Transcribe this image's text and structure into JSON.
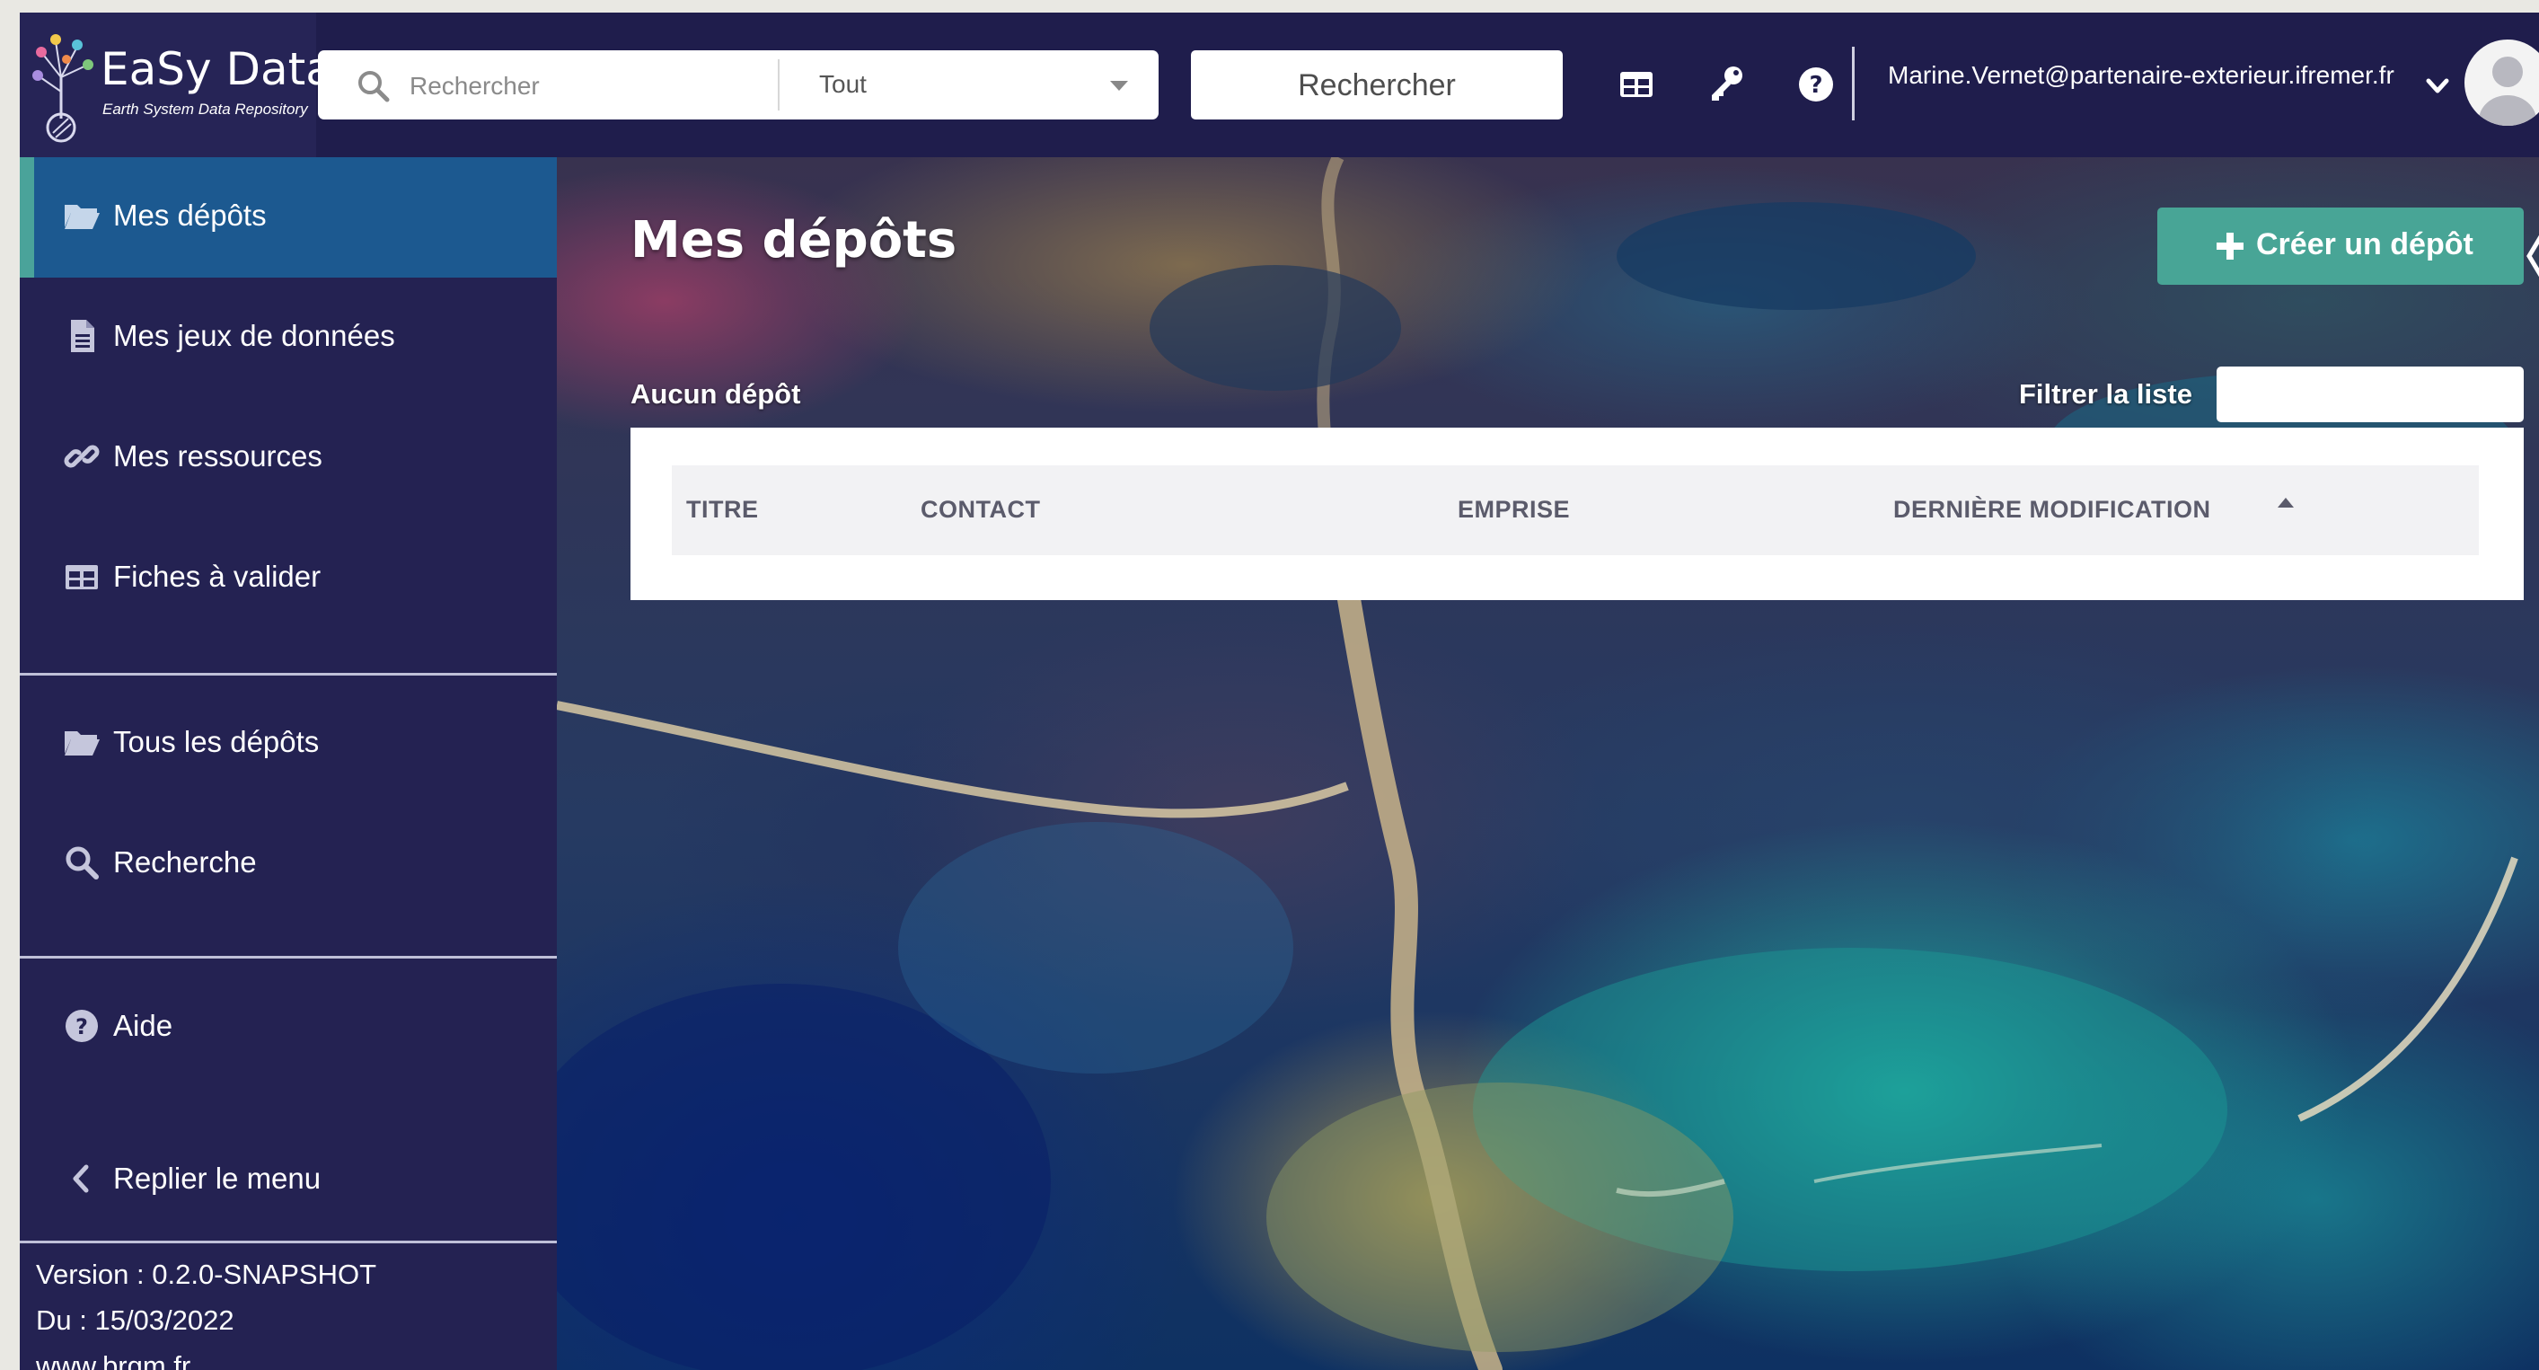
{
  "app": {
    "name": "EaSy Data",
    "tagline": "Earth System Data Repository"
  },
  "header": {
    "search_placeholder": "Rechercher",
    "scope_selected": "Tout",
    "search_button": "Rechercher",
    "icons": [
      "grid-icon",
      "key-icon",
      "help-circle-icon"
    ],
    "user_email": "Marine.Vernet@partenaire-exterieur.ifremer.fr"
  },
  "sidebar": {
    "items": [
      {
        "label": "Mes dépôts",
        "icon": "folder-open-icon",
        "active": true
      },
      {
        "label": "Mes jeux de données",
        "icon": "file-icon"
      },
      {
        "label": "Mes ressources",
        "icon": "link-icon"
      },
      {
        "label": "Fiches à valider",
        "icon": "table-icon"
      },
      {
        "label": "Tous les dépôts",
        "icon": "folder-open-icon"
      },
      {
        "label": "Recherche",
        "icon": "search-icon"
      },
      {
        "label": "Aide",
        "icon": "help-circle-icon"
      },
      {
        "label": "Replier le menu",
        "icon": "chevron-left-icon"
      }
    ],
    "footer": {
      "version": "Version : 0.2.0-SNAPSHOT",
      "date": "Du : 15/03/2022",
      "site": "www.brgm.fr"
    }
  },
  "main": {
    "title": "Mes dépôts",
    "create_button": "Créer un dépôt",
    "empty_text": "Aucun dépôt",
    "filter_label": "Filtrer la liste",
    "filter_value": "",
    "columns": [
      "TITRE",
      "CONTACT",
      "EMPRISE",
      "DERNIÈRE MODIFICATION"
    ],
    "sort_column": "DERNIÈRE MODIFICATION",
    "sort_direction": "ascending",
    "rows": []
  },
  "colors": {
    "topbar": "#1f1d4c",
    "sidebar": "#242252",
    "active_item": "#1c5990",
    "accent": "#48a596"
  }
}
